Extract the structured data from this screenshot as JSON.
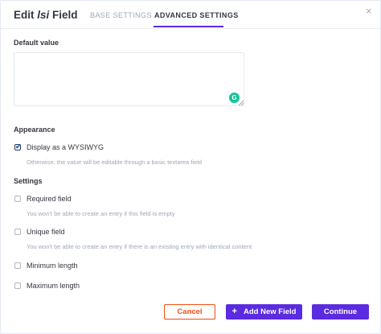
{
  "header": {
    "title_prefix": "Edit ",
    "field_name": "lsi",
    "title_suffix": " Field",
    "tabs": [
      {
        "label": "BASE SETTINGS",
        "active": false
      },
      {
        "label": "ADVANCED SETTINGS",
        "active": true
      }
    ]
  },
  "default_value": {
    "label": "Default value",
    "value": "",
    "placeholder": ""
  },
  "appearance": {
    "heading": "Appearance",
    "wysiwyg": {
      "label": "Display as a WYSIWYG",
      "checked": true,
      "hint": "Otherwise, the value will be editable through a basic textarea field"
    }
  },
  "settings": {
    "heading": "Settings",
    "items": [
      {
        "label": "Required field",
        "checked": false,
        "hint": "You won't be able to create an entry if this field is empty"
      },
      {
        "label": "Unique field",
        "checked": false,
        "hint": "You won't be able to create an entry if there is an existing entry with identical content"
      },
      {
        "label": "Minimum length",
        "checked": false,
        "hint": ""
      },
      {
        "label": "Maximum length",
        "checked": false,
        "hint": ""
      }
    ]
  },
  "footer": {
    "cancel_label": "Cancel",
    "add_new_label": "Add New Field",
    "add_new_icon": "+",
    "continue_label": "Continue"
  },
  "icons": {
    "close": "×",
    "checkmark": "✔",
    "grammarly": "G"
  },
  "colors": {
    "accent": "#5b2be0",
    "cancel": "#f64d0a",
    "check": "#1c5de7",
    "grammarly": "#15c39a"
  }
}
